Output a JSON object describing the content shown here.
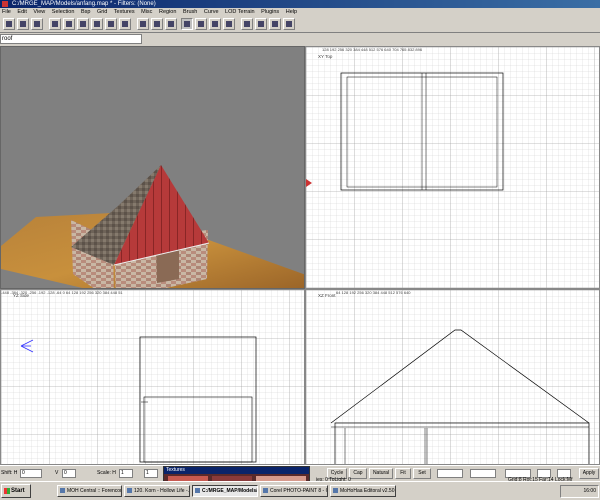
{
  "window": {
    "title": "C:/MRGE_MAP/Models/anfang.map * - Filters: (None)"
  },
  "menu": [
    "File",
    "Edit",
    "View",
    "Selection",
    "Bsp",
    "Grid",
    "Textures",
    "Misc",
    "Region",
    "Brush",
    "Curve",
    "LOD Terrain",
    "Plugins",
    "Help"
  ],
  "path_field": {
    "value": "roof"
  },
  "views": {
    "xy": {
      "label": "XY Top",
      "ruler": "128  192  256  320  384  448  512  576  640  704  765  832  896"
    },
    "yz": {
      "label": "YZ Side",
      "ruler": "-448  -384  -320  -256  -192  -128  -64   0    64   128  192  256  320  384  448  51"
    },
    "xz": {
      "label": "XZ Front",
      "ruler": "64    128   192   256   320   384   448   512   576   640"
    }
  },
  "status_bar": {
    "shift_h_label": "Shift: H",
    "shift_h": "0",
    "v_label": "V",
    "v": "0",
    "scale_h_label": "Scale: H",
    "scale_h": "1",
    "scale_v": "1",
    "buttons": [
      "Cycle",
      "Cap",
      "Natural",
      "Fit",
      "Set"
    ],
    "apply": "Apply",
    "textures_label": "Textures",
    "grid_info": "Grid:8  Rot:15  Far:14  Lock:Mf",
    "selection_info": "ies: 0  ToLight: 0"
  },
  "taskbar": {
    "start": "Start",
    "tasks": [
      "MOH Central :: Forencom...",
      "120. Korn - Hollow Life -...",
      "C:/MRGE_MAP/Models/a...",
      "Corel PHOTO-PAINT 8 - C:...",
      "MoHoHaa Editoral v2.50"
    ],
    "clock": "16:00"
  }
}
